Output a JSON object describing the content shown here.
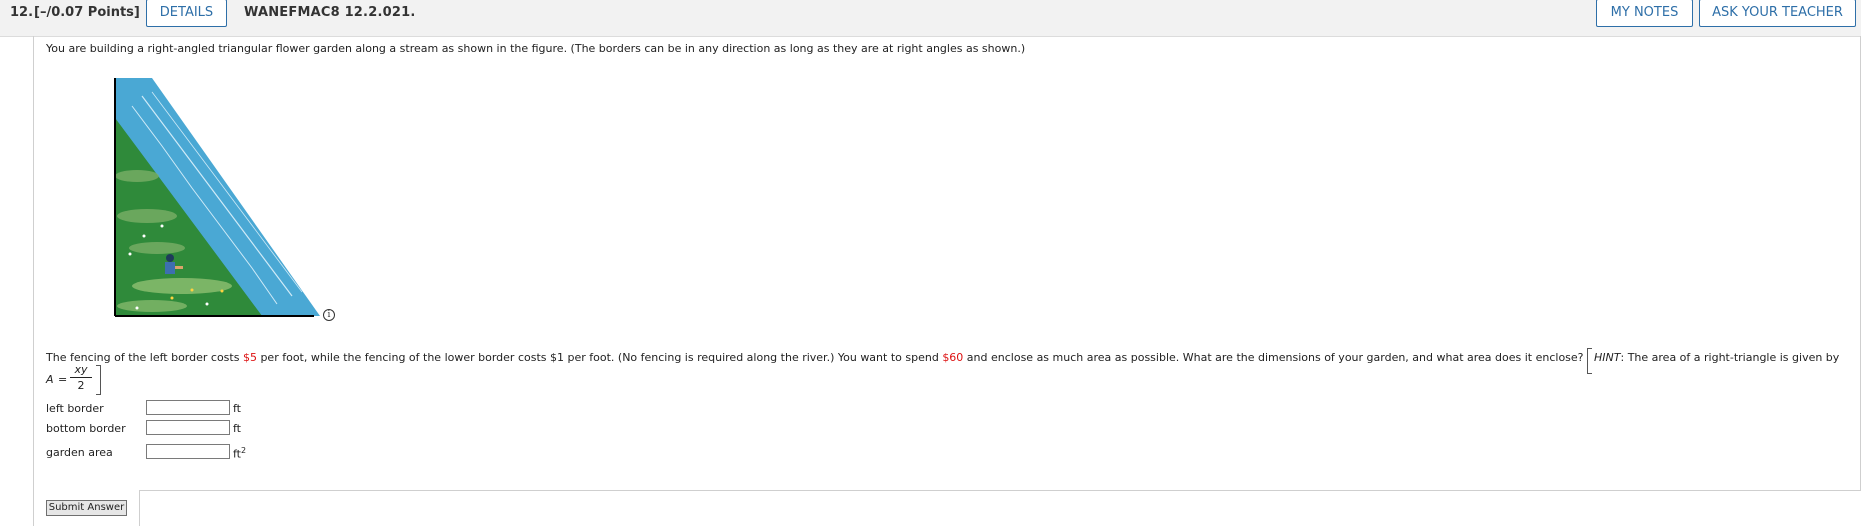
{
  "header": {
    "question_number": "12.",
    "points": "[–/0.07 Points]",
    "details_label": "DETAILS",
    "assignment_code": "WANEFMAC8 12.2.021.",
    "my_notes_label": "MY NOTES",
    "ask_teacher_label": "ASK YOUR TEACHER"
  },
  "question": {
    "intro": "You are building a right-angled triangular flower garden along a stream as shown in the figure. (The borders can be in any direction as long as they are at right angles as shown.)",
    "text_before_cost1": "The fencing of the left border costs ",
    "cost_left": "$5",
    "text_mid1": " per foot, while the fencing of the lower border costs $1 per foot. (No fencing is required along the river.) You want to spend ",
    "budget": "$60",
    "text_after_budget": " and enclose as much area as possible. What are the dimensions of your garden, and what area does it enclose? ",
    "hint_label": "HINT",
    "hint_text": ": The area of a right-triangle is given by",
    "formula_lhs": "A",
    "formula_eq": "=",
    "formula_num": "xy",
    "formula_den": "2"
  },
  "info_icon": "i",
  "fields": [
    {
      "label": "left border",
      "value": "",
      "unit": "ft"
    },
    {
      "label": "bottom border",
      "value": "",
      "unit": "ft"
    },
    {
      "label": "garden area",
      "value": "",
      "unit": "ft",
      "unit_sup": "2"
    }
  ],
  "submit_label": "Submit Answer",
  "colors": {
    "accent": "#2e6fa8",
    "highlight": "#dd1111",
    "stream": "#4aa8d4",
    "grass": "#2f8a3a"
  }
}
